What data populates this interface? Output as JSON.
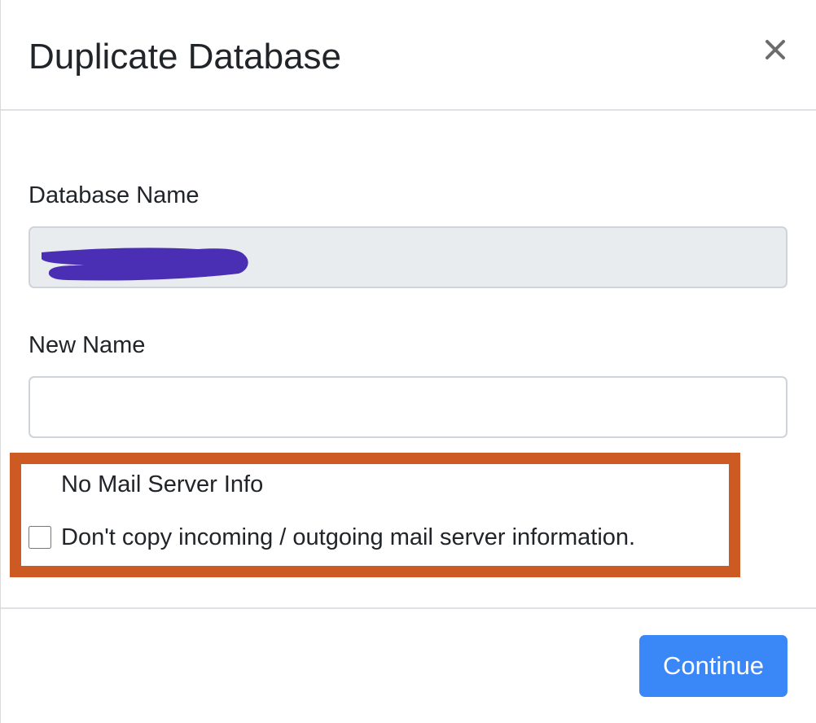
{
  "dialog": {
    "title": "Duplicate Database",
    "close_icon": "close-icon"
  },
  "database_name": {
    "label": "Database Name",
    "value": "",
    "redacted": true,
    "redaction_color": "#4a2fb5"
  },
  "new_name": {
    "label": "New Name",
    "value": ""
  },
  "mail_option": {
    "title": "No Mail Server Info",
    "checkbox_label": "Don't copy incoming / outgoing mail server information.",
    "checked": false,
    "highlight_color": "#cc5a22"
  },
  "footer": {
    "continue_label": "Continue",
    "button_color": "#3a87f7"
  }
}
